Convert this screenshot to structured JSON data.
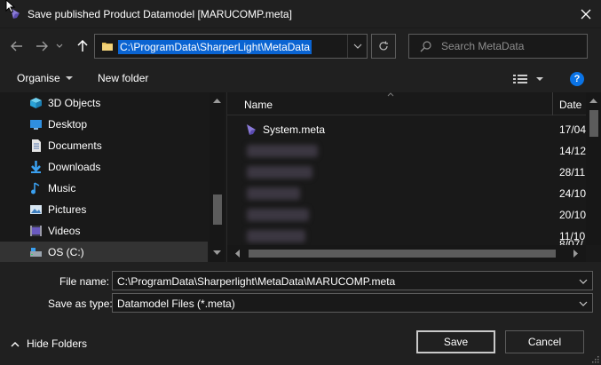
{
  "window": {
    "title": "Save published Product Datamodel [MARUCOMP.meta]",
    "close_icon": "close-icon"
  },
  "nav": {
    "address": "C:\\ProgramData\\SharperLight\\MetaData",
    "search_placeholder": "Search MetaData"
  },
  "toolbar": {
    "organise_label": "Organise",
    "new_folder_label": "New folder",
    "help_label": "?"
  },
  "sidebar": {
    "items": [
      {
        "label": "3D Objects",
        "icon": "cube-icon"
      },
      {
        "label": "Desktop",
        "icon": "desktop-icon"
      },
      {
        "label": "Documents",
        "icon": "documents-icon"
      },
      {
        "label": "Downloads",
        "icon": "downloads-icon"
      },
      {
        "label": "Music",
        "icon": "music-icon"
      },
      {
        "label": "Pictures",
        "icon": "pictures-icon"
      },
      {
        "label": "Videos",
        "icon": "videos-icon"
      },
      {
        "label": "OS (C:)",
        "icon": "drive-icon"
      }
    ]
  },
  "file_list": {
    "columns": {
      "name": "Name",
      "date": "Date"
    },
    "rows": [
      {
        "name": "System.meta",
        "date": "17/04"
      },
      {
        "name": "",
        "date": "14/12"
      },
      {
        "name": "",
        "date": "28/11"
      },
      {
        "name": "",
        "date": "24/10"
      },
      {
        "name": "",
        "date": "20/10"
      },
      {
        "name": "",
        "date": "11/10"
      },
      {
        "name": "",
        "date": "8/07/"
      }
    ]
  },
  "form": {
    "file_name_label": "File name:",
    "file_name_value": "C:\\ProgramData\\Sharperlight\\MetaData\\MARUCOMP.meta",
    "save_type_label": "Save as type:",
    "save_type_value": "Datamodel Files (*.meta)"
  },
  "footer": {
    "hide_folders_label": "Hide Folders",
    "save_label": "Save",
    "cancel_label": "Cancel"
  },
  "colors": {
    "accent": "#0a64d2",
    "background": "#202020",
    "pane": "#191919"
  }
}
